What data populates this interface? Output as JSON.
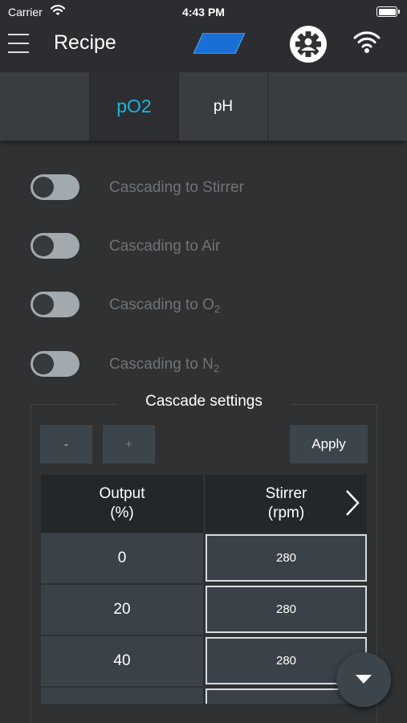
{
  "status_bar": {
    "carrier": "Carrier",
    "time": "4:43 PM",
    "battery_level": 1.0
  },
  "header": {
    "title": "Recipe",
    "menu_icon": "hamburger-icon",
    "logo_color": "#1a6fd6",
    "settings_icon": "gear-icon",
    "connection_icon": "wifi-icon"
  },
  "tabs": [
    {
      "label": "",
      "selected": false
    },
    {
      "label": "pO2",
      "selected": true
    },
    {
      "label": "pH",
      "selected": false
    },
    {
      "label": "",
      "selected": false
    }
  ],
  "cascades": [
    {
      "label": "Cascading to Stirrer",
      "sub": "",
      "on": false
    },
    {
      "label": "Cascading to Air",
      "sub": "",
      "on": false
    },
    {
      "label": "Cascading to O",
      "sub": "2",
      "on": false
    },
    {
      "label": "Cascading to N",
      "sub": "2",
      "on": false
    }
  ],
  "cascade_settings": {
    "title": "Cascade settings",
    "minus_label": "-",
    "plus_label": "+",
    "apply_label": "Apply",
    "columns": [
      {
        "line1": "Output",
        "line2": "(%)"
      },
      {
        "line1": "Stirrer",
        "line2": "(rpm)"
      }
    ],
    "rows": [
      {
        "output": "0",
        "stirrer": "280"
      },
      {
        "output": "20",
        "stirrer": "280"
      },
      {
        "output": "40",
        "stirrer": "280"
      }
    ]
  },
  "colors": {
    "accent": "#19b5e0",
    "background": "#2f3133",
    "cell": "#3a4148"
  }
}
